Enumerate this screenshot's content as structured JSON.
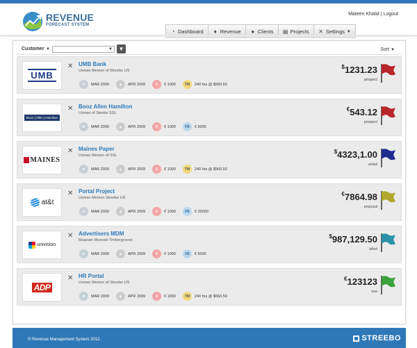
{
  "app": {
    "logo_title": "REVENUE",
    "logo_subtitle": "FORECAST SYSTEM",
    "brand_color": "#2e78b7"
  },
  "user": {
    "name": "Mateen Khalid",
    "separator": "|",
    "logout": "Logout"
  },
  "nav": [
    {
      "label": "Dashboard",
      "icon": "dashboard-icon"
    },
    {
      "label": "Revenue",
      "icon": "money-bag-icon"
    },
    {
      "label": "Clients",
      "icon": "user-icon"
    },
    {
      "label": "Projects",
      "icon": "document-icon"
    },
    {
      "label": "Settings",
      "icon": "tools-icon"
    }
  ],
  "filters": {
    "customer_label": "Customer",
    "customer_value": "",
    "sort_label": "Sort"
  },
  "projects": [
    {
      "name": "UMB Bank",
      "client": "Usman Memon of Streebo US",
      "logo": "UMB",
      "start": "MAR 2009",
      "end": "APR 2009",
      "rate": "€ 1000",
      "billing_type": "TM",
      "billing": "240 hrs @ $560.50",
      "currency": "$",
      "amount": "1231.23",
      "status": "prospect",
      "flag_color": "#b8262b"
    },
    {
      "name": "Booz Allen Hamilton",
      "client": "Usman of Steebo SSL",
      "logo": "Booz | Allen | Hamilton",
      "start": "MAR 2009",
      "end": "APR 2009",
      "rate": "€ 1000",
      "billing_type": "FB",
      "billing": "€ 5000",
      "currency": "€",
      "amount": "543.12",
      "status": "prospect",
      "flag_color": "#b8262b"
    },
    {
      "name": "Maines Paper",
      "client": "Usman Memon of SSL",
      "logo": "MAINES",
      "start": "MAR 2009",
      "end": "APR 2009",
      "rate": "€ 1000",
      "billing_type": "TM",
      "billing": "240 hrs @ $560.50",
      "currency": "$",
      "amount": "4323,1.00",
      "status": "verbal",
      "flag_color": "#1e2b8f"
    },
    {
      "name": "Portal Project",
      "client": "Usman Memon Streebo US",
      "logo": "at&t",
      "start": "MAR 2009",
      "end": "APR 2009",
      "rate": "€ 1000",
      "billing_type": "FB",
      "billing": "€ 32000",
      "currency": "€",
      "amount": "7864.98",
      "status": "proposal",
      "flag_color": "#b0a82a"
    },
    {
      "name": "Advertisers MDM",
      "client": "Muazam Muneeb Timbergroove",
      "logo": "univision",
      "start": "MAR 2009",
      "end": "APR 2009",
      "rate": "€ 1000",
      "billing_type": "FB",
      "billing": "€ 5000",
      "currency": "$",
      "amount": "987,129.50",
      "status": "billed",
      "flag_color": "#2b93a8"
    },
    {
      "name": "HR Portal",
      "client": "Usman Memon of Streebo US",
      "logo": "ADP",
      "start": "MAR 2009",
      "end": "APR 2009",
      "rate": "€ 1000",
      "billing_type": "TM",
      "billing": "240 hrs @ $560.50",
      "currency": "€",
      "amount": "123123",
      "status": "sow",
      "flag_color": "#3aa23a"
    }
  ],
  "footer": {
    "copyright": "© Revenue Management System 2012.",
    "brand": "STREEBO"
  }
}
